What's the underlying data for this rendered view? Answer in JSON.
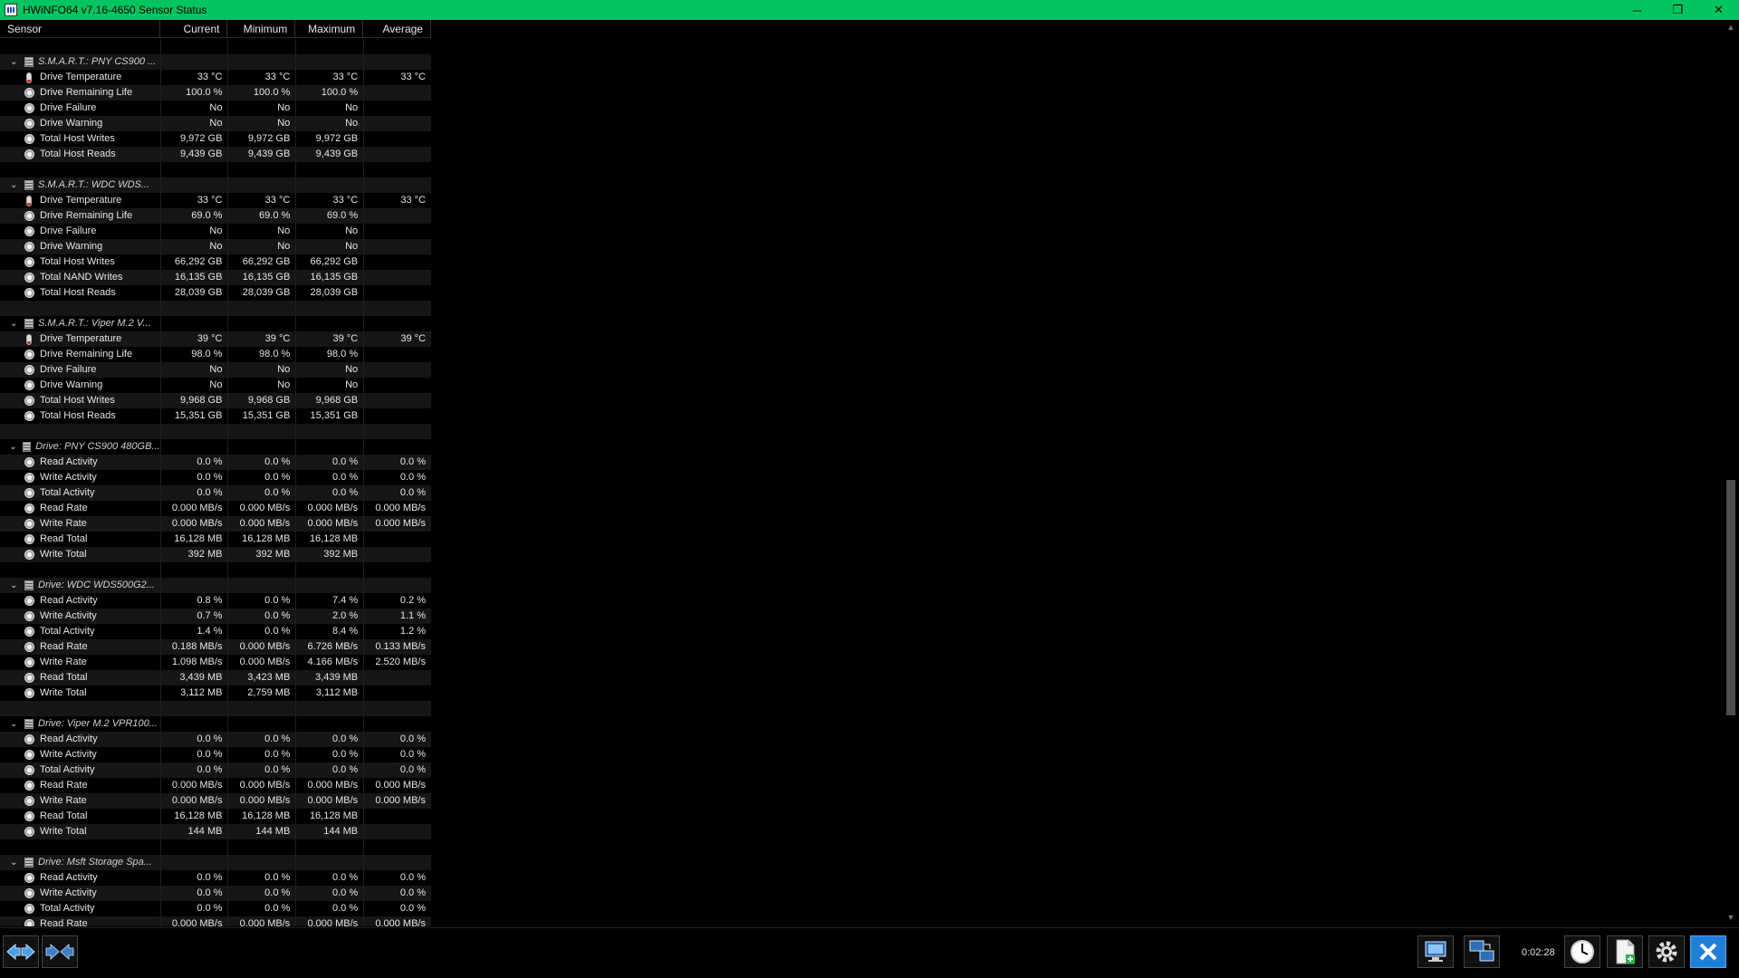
{
  "window": {
    "title": "HWiNFO64 v7.16-4650 Sensor Status",
    "minimize": "─",
    "restore": "❐",
    "close": "✕"
  },
  "columns": [
    "Sensor",
    "Current",
    "Minimum",
    "Maximum",
    "Average"
  ],
  "groups": [
    {
      "name": "S.M.A.R.T.: PNY CS900 ...",
      "rows": [
        {
          "icon": "thermometer-icon",
          "label": "Drive Temperature",
          "cur": "33 °C",
          "min": "33 °C",
          "max": "33 °C",
          "avg": "33 °C"
        },
        {
          "icon": "clock-icon",
          "label": "Drive Remaining Life",
          "cur": "100.0 %",
          "min": "100.0 %",
          "max": "100.0 %",
          "avg": ""
        },
        {
          "icon": "clock-icon",
          "label": "Drive Failure",
          "cur": "No",
          "min": "No",
          "max": "No",
          "avg": ""
        },
        {
          "icon": "clock-icon",
          "label": "Drive Warning",
          "cur": "No",
          "min": "No",
          "max": "No",
          "avg": ""
        },
        {
          "icon": "clock-icon",
          "label": "Total Host Writes",
          "cur": "9,972 GB",
          "min": "9,972 GB",
          "max": "9,972 GB",
          "avg": ""
        },
        {
          "icon": "clock-icon",
          "label": "Total Host Reads",
          "cur": "9,439 GB",
          "min": "9,439 GB",
          "max": "9,439 GB",
          "avg": ""
        }
      ]
    },
    {
      "name": "S.M.A.R.T.: WDC WDS...",
      "rows": [
        {
          "icon": "thermometer-icon",
          "label": "Drive Temperature",
          "cur": "33 °C",
          "min": "33 °C",
          "max": "33 °C",
          "avg": "33 °C"
        },
        {
          "icon": "clock-icon",
          "label": "Drive Remaining Life",
          "cur": "69.0 %",
          "min": "69.0 %",
          "max": "69.0 %",
          "avg": ""
        },
        {
          "icon": "clock-icon",
          "label": "Drive Failure",
          "cur": "No",
          "min": "No",
          "max": "No",
          "avg": ""
        },
        {
          "icon": "clock-icon",
          "label": "Drive Warning",
          "cur": "No",
          "min": "No",
          "max": "No",
          "avg": ""
        },
        {
          "icon": "clock-icon",
          "label": "Total Host Writes",
          "cur": "66,292 GB",
          "min": "66,292 GB",
          "max": "66,292 GB",
          "avg": ""
        },
        {
          "icon": "clock-icon",
          "label": "Total NAND Writes",
          "cur": "16,135 GB",
          "min": "16,135 GB",
          "max": "16,135 GB",
          "avg": ""
        },
        {
          "icon": "clock-icon",
          "label": "Total Host Reads",
          "cur": "28,039 GB",
          "min": "28,039 GB",
          "max": "28,039 GB",
          "avg": ""
        }
      ]
    },
    {
      "name": "S.M.A.R.T.: Viper M.2 V...",
      "rows": [
        {
          "icon": "thermometer-icon",
          "label": "Drive Temperature",
          "cur": "39 °C",
          "min": "39 °C",
          "max": "39 °C",
          "avg": "39 °C"
        },
        {
          "icon": "clock-icon",
          "label": "Drive Remaining Life",
          "cur": "98.0 %",
          "min": "98.0 %",
          "max": "98.0 %",
          "avg": ""
        },
        {
          "icon": "clock-icon",
          "label": "Drive Failure",
          "cur": "No",
          "min": "No",
          "max": "No",
          "avg": ""
        },
        {
          "icon": "clock-icon",
          "label": "Drive Warning",
          "cur": "No",
          "min": "No",
          "max": "No",
          "avg": ""
        },
        {
          "icon": "clock-icon",
          "label": "Total Host Writes",
          "cur": "9,968 GB",
          "min": "9,968 GB",
          "max": "9,968 GB",
          "avg": ""
        },
        {
          "icon": "clock-icon",
          "label": "Total Host Reads",
          "cur": "15,351 GB",
          "min": "15,351 GB",
          "max": "15,351 GB",
          "avg": ""
        }
      ]
    },
    {
      "name": "Drive: PNY CS900 480GB...",
      "rows": [
        {
          "icon": "clock-icon",
          "label": "Read Activity",
          "cur": "0.0 %",
          "min": "0.0 %",
          "max": "0.0 %",
          "avg": "0.0 %"
        },
        {
          "icon": "clock-icon",
          "label": "Write Activity",
          "cur": "0.0 %",
          "min": "0.0 %",
          "max": "0.0 %",
          "avg": "0.0 %"
        },
        {
          "icon": "clock-icon",
          "label": "Total Activity",
          "cur": "0.0 %",
          "min": "0.0 %",
          "max": "0.0 %",
          "avg": "0.0 %"
        },
        {
          "icon": "clock-icon",
          "label": "Read Rate",
          "cur": "0.000 MB/s",
          "min": "0.000 MB/s",
          "max": "0.000 MB/s",
          "avg": "0.000 MB/s"
        },
        {
          "icon": "clock-icon",
          "label": "Write Rate",
          "cur": "0.000 MB/s",
          "min": "0.000 MB/s",
          "max": "0.000 MB/s",
          "avg": "0.000 MB/s"
        },
        {
          "icon": "clock-icon",
          "label": "Read Total",
          "cur": "16,128 MB",
          "min": "16,128 MB",
          "max": "16,128 MB",
          "avg": ""
        },
        {
          "icon": "clock-icon",
          "label": "Write Total",
          "cur": "392 MB",
          "min": "392 MB",
          "max": "392 MB",
          "avg": ""
        }
      ]
    },
    {
      "name": "Drive: WDC WDS500G2...",
      "rows": [
        {
          "icon": "clock-icon",
          "label": "Read Activity",
          "cur": "0.8 %",
          "min": "0.0 %",
          "max": "7.4 %",
          "avg": "0.2 %"
        },
        {
          "icon": "clock-icon",
          "label": "Write Activity",
          "cur": "0.7 %",
          "min": "0.0 %",
          "max": "2.0 %",
          "avg": "1.1 %"
        },
        {
          "icon": "clock-icon",
          "label": "Total Activity",
          "cur": "1.4 %",
          "min": "0.0 %",
          "max": "8.4 %",
          "avg": "1.2 %"
        },
        {
          "icon": "clock-icon",
          "label": "Read Rate",
          "cur": "0.188 MB/s",
          "min": "0.000 MB/s",
          "max": "6.726 MB/s",
          "avg": "0.133 MB/s"
        },
        {
          "icon": "clock-icon",
          "label": "Write Rate",
          "cur": "1.098 MB/s",
          "min": "0.000 MB/s",
          "max": "4.166 MB/s",
          "avg": "2.520 MB/s"
        },
        {
          "icon": "clock-icon",
          "label": "Read Total",
          "cur": "3,439 MB",
          "min": "3,423 MB",
          "max": "3,439 MB",
          "avg": ""
        },
        {
          "icon": "clock-icon",
          "label": "Write Total",
          "cur": "3,112 MB",
          "min": "2,759 MB",
          "max": "3,112 MB",
          "avg": ""
        }
      ]
    },
    {
      "name": "Drive: Viper M.2 VPR100...",
      "rows": [
        {
          "icon": "clock-icon",
          "label": "Read Activity",
          "cur": "0.0 %",
          "min": "0.0 %",
          "max": "0.0 %",
          "avg": "0.0 %"
        },
        {
          "icon": "clock-icon",
          "label": "Write Activity",
          "cur": "0.0 %",
          "min": "0.0 %",
          "max": "0.0 %",
          "avg": "0.0 %"
        },
        {
          "icon": "clock-icon",
          "label": "Total Activity",
          "cur": "0.0 %",
          "min": "0.0 %",
          "max": "0.0 %",
          "avg": "0.0 %"
        },
        {
          "icon": "clock-icon",
          "label": "Read Rate",
          "cur": "0.000 MB/s",
          "min": "0.000 MB/s",
          "max": "0.000 MB/s",
          "avg": "0.000 MB/s"
        },
        {
          "icon": "clock-icon",
          "label": "Write Rate",
          "cur": "0.000 MB/s",
          "min": "0.000 MB/s",
          "max": "0.000 MB/s",
          "avg": "0.000 MB/s"
        },
        {
          "icon": "clock-icon",
          "label": "Read Total",
          "cur": "16,128 MB",
          "min": "16,128 MB",
          "max": "16,128 MB",
          "avg": ""
        },
        {
          "icon": "clock-icon",
          "label": "Write Total",
          "cur": "144 MB",
          "min": "144 MB",
          "max": "144 MB",
          "avg": ""
        }
      ]
    },
    {
      "name": "Drive: Msft Storage Spa...",
      "rows": [
        {
          "icon": "clock-icon",
          "label": "Read Activity",
          "cur": "0.0 %",
          "min": "0.0 %",
          "max": "0.0 %",
          "avg": "0.0 %"
        },
        {
          "icon": "clock-icon",
          "label": "Write Activity",
          "cur": "0.0 %",
          "min": "0.0 %",
          "max": "0.0 %",
          "avg": "0.0 %"
        },
        {
          "icon": "clock-icon",
          "label": "Total Activity",
          "cur": "0.0 %",
          "min": "0.0 %",
          "max": "0.0 %",
          "avg": "0.0 %"
        },
        {
          "icon": "clock-icon",
          "label": "Read Rate",
          "cur": "0.000 MB/s",
          "min": "0.000 MB/s",
          "max": "0.000 MB/s",
          "avg": "0.000 MB/s"
        }
      ]
    }
  ],
  "toolbar": {
    "timer": "0:02:28",
    "buttons": [
      "expand-collapse-icon",
      "reset-layout-icon",
      "network-icon",
      "remote-icon",
      "clock-icon",
      "log-file-icon",
      "settings-gear-icon",
      "close-icon"
    ]
  },
  "colors": {
    "titlebar": "#00c560",
    "background": "#000000",
    "text": "#e6e6e6",
    "close_button": "#1e7fd6"
  }
}
